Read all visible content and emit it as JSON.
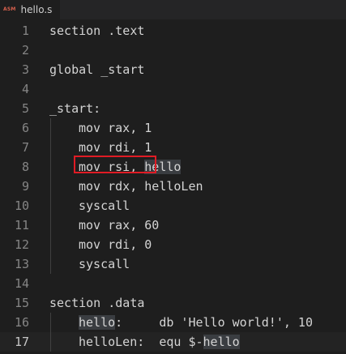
{
  "tab": {
    "icon_label": "ASM",
    "title": "hello.s"
  },
  "code_lines": [
    {
      "num": "1",
      "text": "section .text"
    },
    {
      "num": "2",
      "text": ""
    },
    {
      "num": "3",
      "text": "global _start"
    },
    {
      "num": "4",
      "text": ""
    },
    {
      "num": "5",
      "text": "_start:"
    },
    {
      "num": "6",
      "text": "mov rax, 1"
    },
    {
      "num": "7",
      "text": "mov rdi, 1"
    },
    {
      "num": "8",
      "before": "mov rsi, ",
      "highlight": "hello",
      "after": ""
    },
    {
      "num": "9",
      "text": "mov rdx, helloLen"
    },
    {
      "num": "10",
      "text": "syscall"
    },
    {
      "num": "11",
      "text": "mov rax, 60"
    },
    {
      "num": "12",
      "text": "mov rdi, 0"
    },
    {
      "num": "13",
      "text": "syscall"
    },
    {
      "num": "14",
      "text": ""
    },
    {
      "num": "15",
      "text": "section .data"
    },
    {
      "num": "16",
      "highlight": "hello",
      "after": ":     db 'Hello world!', 10"
    },
    {
      "num": "17",
      "before": "helloLen:  equ $-",
      "highlight": "hello",
      "after": ""
    }
  ],
  "colors": {
    "background": "#1e1e1e",
    "line_number": "#858585",
    "text": "#d4d4d4",
    "word_highlight": "#3a3d41",
    "annotation_box": "#e01b24"
  }
}
